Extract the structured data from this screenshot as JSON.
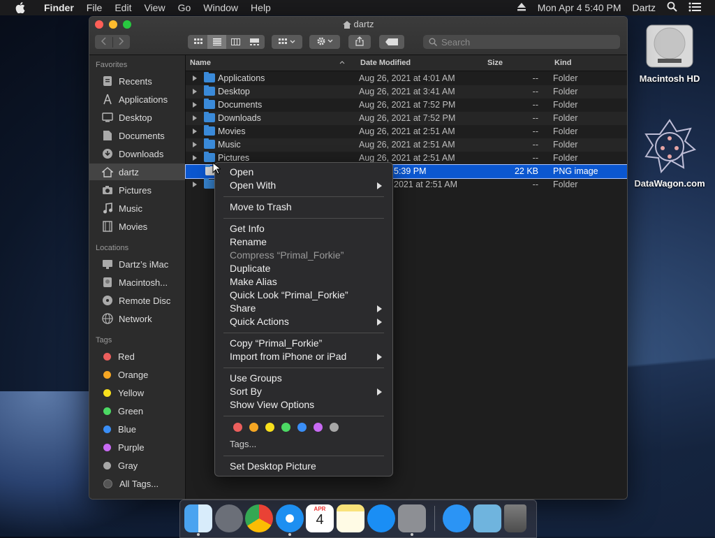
{
  "menubar": {
    "app": "Finder",
    "items": [
      "File",
      "Edit",
      "View",
      "Go",
      "Window",
      "Help"
    ],
    "clock": "Mon Apr 4  5:40 PM",
    "user": "Dartz"
  },
  "window": {
    "title": "dartz",
    "search_placeholder": "Search"
  },
  "sidebar": {
    "favorites_header": "Favorites",
    "favorites": [
      "Recents",
      "Applications",
      "Desktop",
      "Documents",
      "Downloads",
      "dartz",
      "Pictures",
      "Music",
      "Movies"
    ],
    "locations_header": "Locations",
    "locations": [
      "Dartz’s iMac",
      "Macintosh...",
      "Remote Disc",
      "Network"
    ],
    "tags_header": "Tags",
    "tags": [
      {
        "label": "Red",
        "color": "#ec5f5d"
      },
      {
        "label": "Orange",
        "color": "#f5a623"
      },
      {
        "label": "Yellow",
        "color": "#f8e01c"
      },
      {
        "label": "Green",
        "color": "#4cd964"
      },
      {
        "label": "Blue",
        "color": "#3a8ef6"
      },
      {
        "label": "Purple",
        "color": "#c86af3"
      },
      {
        "label": "Gray",
        "color": "#a7a7a7"
      },
      {
        "label": "All Tags...",
        "color": "#555555"
      }
    ]
  },
  "list": {
    "columns": [
      "Name",
      "Date Modified",
      "Size",
      "Kind"
    ],
    "rows": [
      {
        "name": "Applications",
        "date": "Aug 26, 2021 at 4:01 AM",
        "size": "--",
        "kind": "Folder"
      },
      {
        "name": "Desktop",
        "date": "Aug 26, 2021 at 3:41 AM",
        "size": "--",
        "kind": "Folder"
      },
      {
        "name": "Documents",
        "date": "Aug 26, 2021 at 7:52 PM",
        "size": "--",
        "kind": "Folder"
      },
      {
        "name": "Downloads",
        "date": "Aug 26, 2021 at 7:52 PM",
        "size": "--",
        "kind": "Folder"
      },
      {
        "name": "Movies",
        "date": "Aug 26, 2021 at 2:51 AM",
        "size": "--",
        "kind": "Folder"
      },
      {
        "name": "Music",
        "date": "Aug 26, 2021 at 2:51 AM",
        "size": "--",
        "kind": "Folder"
      },
      {
        "name": "Pictures",
        "date": "Aug 26, 2021 at 2:51 AM",
        "size": "--",
        "kind": "Folder"
      },
      {
        "name": "",
        "date": "5:39 PM",
        "size": "22 KB",
        "kind": "PNG image"
      },
      {
        "name": "",
        "date": "2021 at 2:51 AM",
        "size": "--",
        "kind": "Folder"
      }
    ]
  },
  "context_menu": {
    "open": "Open",
    "open_with": "Open With",
    "move_to_trash": "Move to Trash",
    "get_info": "Get Info",
    "rename": "Rename",
    "compress": "Compress “Primal_Forkie”",
    "duplicate": "Duplicate",
    "make_alias": "Make Alias",
    "quick_look": "Quick Look “Primal_Forkie”",
    "share": "Share",
    "quick_actions": "Quick Actions",
    "copy": "Copy “Primal_Forkie”",
    "import": "Import from iPhone or iPad",
    "use_groups": "Use Groups",
    "sort_by": "Sort By",
    "show_view_options": "Show View Options",
    "tag_colors": [
      "#ec5f5d",
      "#f5a623",
      "#f8e01c",
      "#4cd964",
      "#3a8ef6",
      "#c86af3",
      "#a7a7a7"
    ],
    "tags": "Tags...",
    "set_desktop_picture": "Set Desktop Picture"
  },
  "desktop": {
    "hd_label": "Macintosh HD",
    "datawagon_label": "DataWagon.com"
  },
  "dock": {
    "apps": [
      "finder-icon",
      "launchpad-icon",
      "chrome-icon",
      "safari-icon",
      "calendar-icon",
      "notes-icon",
      "app-store-icon",
      "system-preferences-icon",
      "app-store-downloads-icon",
      "downloads-folder-icon",
      "trash-icon"
    ],
    "calendar_month": "APR",
    "calendar_day": "4"
  }
}
